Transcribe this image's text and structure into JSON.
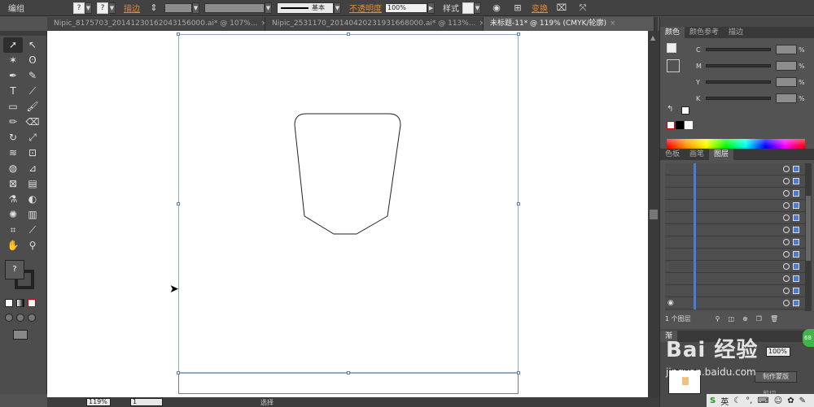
{
  "control_bar": {
    "mode_label": "编组",
    "fill_symbol": "?",
    "stroke_symbol": "?",
    "stroke_label": "描边",
    "stroke_style": "基本",
    "opacity_label": "不透明度",
    "opacity_value": "100%",
    "style_label": "样式",
    "transform_label": "变换"
  },
  "tabs": [
    {
      "label": "Nipic_8175703_20141230162043156000.ai* @ 107%..."
    },
    {
      "label": "Nipic_2531170_20140420231931668000.ai* @ 113%..."
    },
    {
      "label": "未标题-11* @ 119% (CMYK/轮廓)"
    }
  ],
  "tools": {
    "fill_symbol": "?"
  },
  "status_bar": {
    "zoom": "119%",
    "page": "1",
    "tool_name": "选择"
  },
  "panels": {
    "color_tabs": [
      "颜色",
      "颜色参考",
      "描边"
    ],
    "cmyk": [
      {
        "channel": "C",
        "pct": "%"
      },
      {
        "channel": "M",
        "pct": "%"
      },
      {
        "channel": "Y",
        "pct": "%"
      },
      {
        "channel": "K",
        "pct": "%"
      }
    ],
    "layers_tabs": [
      "色板",
      "画笔",
      "图层"
    ],
    "layers_footer": "1 个图层",
    "transparency_tab": "渐",
    "opacity_value": "100%",
    "mask_button": "制作蒙版",
    "clip_label": "剪切"
  },
  "taskbar": {
    "ime_label": "英"
  },
  "watermark": {
    "main": "Bai 经验",
    "sub": "jingyan.baidu.com",
    "badge": "68"
  }
}
